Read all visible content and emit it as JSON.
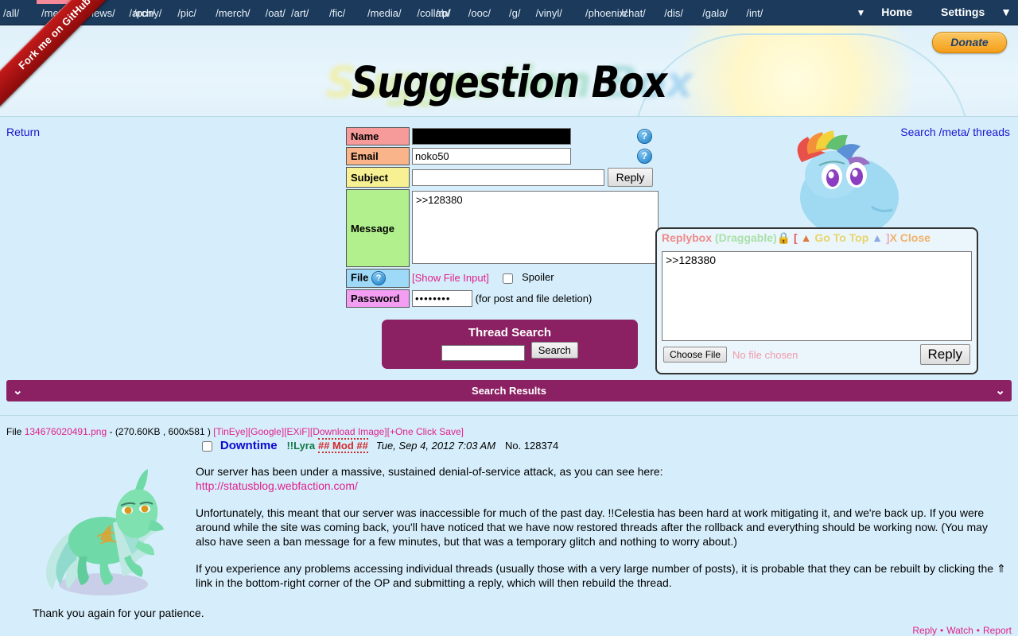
{
  "nav": {
    "groups": [
      {
        "items": [
          "/all/",
          "/meta/",
          "/news/",
          "/arch/"
        ],
        "active": "/meta/"
      },
      {
        "items": [
          "/pony/",
          "/pic/",
          "/merch/",
          "/oat/"
        ]
      },
      {
        "items": [
          "/art/",
          "/fic/",
          "/media/",
          "/collab/"
        ]
      },
      {
        "items": [
          "/rp/",
          "/ooc/"
        ]
      },
      {
        "items": [
          "/g/",
          "/vinyl/",
          "/phoenix/"
        ]
      },
      {
        "items": [
          "/chat/",
          "/dis/",
          "/gala/",
          "/int/"
        ]
      }
    ],
    "right": {
      "caret": "▼",
      "home": "Home",
      "settings": "Settings",
      "settings_caret": "▼"
    }
  },
  "ribbon": {
    "label": "Fork me on GitHub"
  },
  "header": {
    "title": "Suggestion Box",
    "donate": "Donate",
    "return_link": "Return",
    "search_threads_link": "Search /meta/ threads"
  },
  "form": {
    "labels": {
      "name": "Name",
      "email": "Email",
      "subject": "Subject",
      "message": "Message",
      "file": "File",
      "password": "Password"
    },
    "name_value": "",
    "email_value": "noko50",
    "subject_value": "",
    "subject_placeholder": "",
    "message_value": ">>128380",
    "reply_button": "Reply",
    "show_file_input": "[Show File Input]",
    "spoiler_label": "Spoiler",
    "spoiler_checked": false,
    "password_value": "••••••••",
    "password_note": "(for post and file deletion)",
    "help_icon": "?"
  },
  "thread_search": {
    "title": "Thread Search",
    "input_value": "",
    "button": "Search"
  },
  "replybox": {
    "title_parts": [
      {
        "text": "Replybox",
        "color": "#f08a8a"
      },
      {
        "text": " (Draggable)",
        "color": "#a9e0a9"
      },
      {
        "text": "🔒",
        "color": "#8fbf4f"
      },
      {
        "text": "  [",
        "color": "#e05858"
      },
      {
        "text": " ▲ ",
        "color": "#e07a3c"
      },
      {
        "text": "Go To Top",
        "color": "#e8d46a"
      },
      {
        "text": " ▲ ",
        "color": "#8fa8e0"
      },
      {
        "text": "]",
        "color": "#f0a8c8"
      },
      {
        "text": "X Close",
        "color": "#f0b26a"
      }
    ],
    "text_value": ">>128380",
    "choose_file": "Choose File",
    "no_file": "No file chosen",
    "reply_button": "Reply"
  },
  "results": {
    "bar_title": "Search Results",
    "chevron_left": "⌄",
    "chevron_right": "⌄"
  },
  "post": {
    "file_prefix": "File",
    "file_name": "134676020491.png",
    "file_meta": "- (270.60KB , 600x581 )",
    "file_links": [
      "[TinEye]",
      "[Google]",
      "[EXiF]",
      "[Download Image]",
      "[+One Click Save]"
    ],
    "subject": "Downtime",
    "author": "!!Lyra",
    "capcode": "## Mod ##",
    "date": "Tue, Sep 4, 2012 7:03 AM",
    "number": "No. 128374",
    "paragraphs": [
      "Our server has been under a massive, sustained denial-of-service attack, as you can see here:",
      "Unfortunately, this meant that our server was inaccessible for much of the past day. !!Celestia has been hard at work mitigating it, and we're back up. If you were around while the site was coming back, you'll have noticed that we have now restored threads after the rollback and everything should be working now. (You may also have seen a ban message for a few minutes, but that was a temporary glitch and nothing to worry about.)",
      "If you experience any problems accessing individual threads (usually those with a very large number of posts), it is probable that they can be rebuilt by clicking the ⇑ link in the bottom-right corner of the OP and submitting a reply, which will then rebuild the thread."
    ],
    "link_url": "http://statusblog.webfaction.com/",
    "closing": "Thank you again for your patience.",
    "footer_links": [
      "Reply",
      "Watch",
      "Report"
    ],
    "footer_sep": "•"
  },
  "colors": {
    "nav_bg": "#1b3a5c",
    "page_bg": "#d6eefb",
    "accent_purple": "#8b2163",
    "link_pink": "#e0208b",
    "link_blue": "#1616d0"
  }
}
